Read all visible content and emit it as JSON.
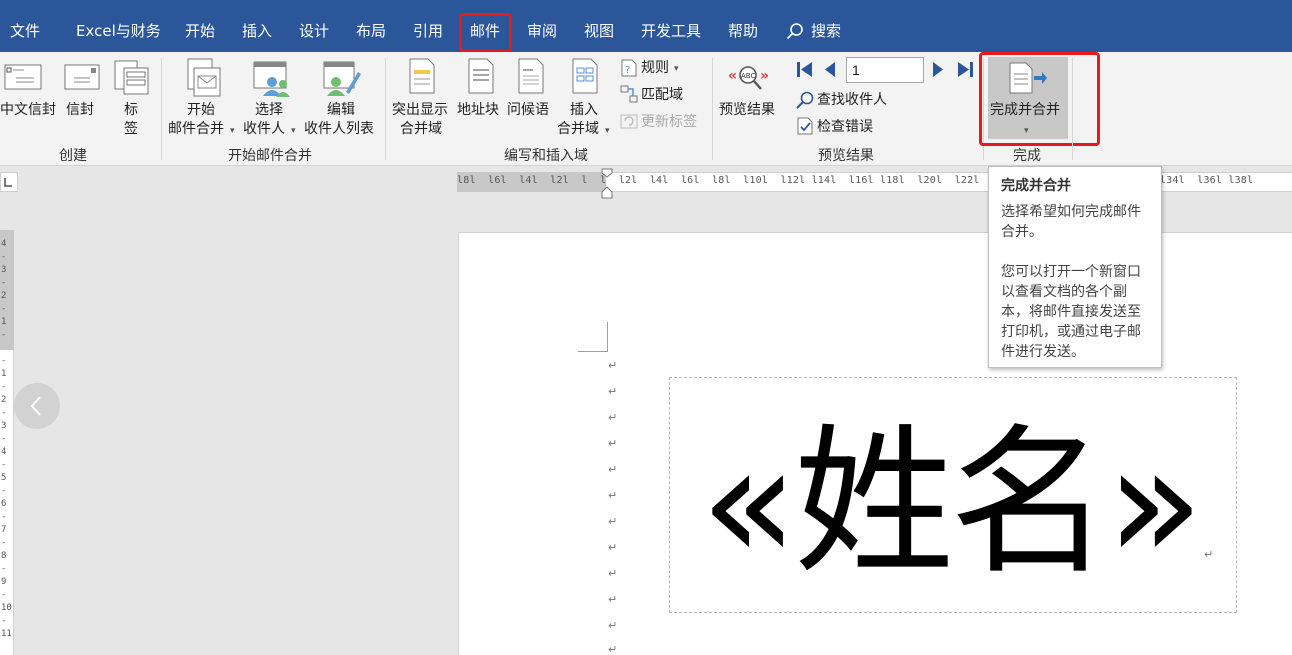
{
  "tabs": {
    "file": "文件",
    "excel": "Excel与财务",
    "home": "开始",
    "insert": "插入",
    "design": "设计",
    "layout": "布局",
    "references": "引用",
    "mailings": "邮件",
    "review": "审阅",
    "view": "视图",
    "developer": "开发工具",
    "help": "帮助",
    "search": "搜索"
  },
  "ribbon": {
    "create": {
      "label": "创建",
      "chinese_envelope": "中文信封",
      "envelope": "信封",
      "labels_line1": "标",
      "labels_line2": "签"
    },
    "start_merge": {
      "label": "开始邮件合并",
      "start_line1": "开始",
      "start_line2": "邮件合并",
      "select_line1": "选择",
      "select_line2": "收件人",
      "edit_line1": "编辑",
      "edit_line2": "收件人列表"
    },
    "write_insert": {
      "label": "编写和插入域",
      "highlight_line1": "突出显示",
      "highlight_line2": "合并域",
      "address_block": "地址块",
      "greeting": "问候语",
      "insert_line1": "插入",
      "insert_line2": "合并域",
      "rules": "规则",
      "match_fields": "匹配域",
      "update_labels": "更新标签"
    },
    "preview": {
      "label": "预览结果",
      "preview_results": "预览结果",
      "record_value": "1",
      "find_recipient": "查找收件人",
      "check_errors": "检查错误"
    },
    "finish": {
      "label": "完成",
      "finish_merge": "完成并合并"
    }
  },
  "ruler": {
    "horizontal": "l8l  l6l  l4l  l2l  l  l  l2l  l4l  l6l  l8l  l10l  l12l l14l  l16l l18l  l20l  l22l  l24l l26l  l28l l30l  l32l l34l  l36l l38l",
    "vertical": "4\n-\n3\n-\n2\n-\n1\n-\n \n-\n1\n-\n2\n-\n3\n-\n4\n-\n5\n-\n6\n-\n7\n-\n8\n-\n9\n-\n10\n-\n11"
  },
  "document": {
    "merge_field": "«姓名»",
    "para_mark": "↵"
  },
  "tooltip": {
    "title": "完成并合并",
    "line1": "选择希望如何完成邮件",
    "line2": "合并。",
    "line3": "您可以打开一个新窗口",
    "line4": "以查看文档的各个副",
    "line5": "本，将邮件直接发送至",
    "line6": "打印机，或通过电子邮",
    "line7": "件进行发送。"
  },
  "colors": {
    "accent": "#2b579a",
    "highlight_box": "#e8191c"
  }
}
